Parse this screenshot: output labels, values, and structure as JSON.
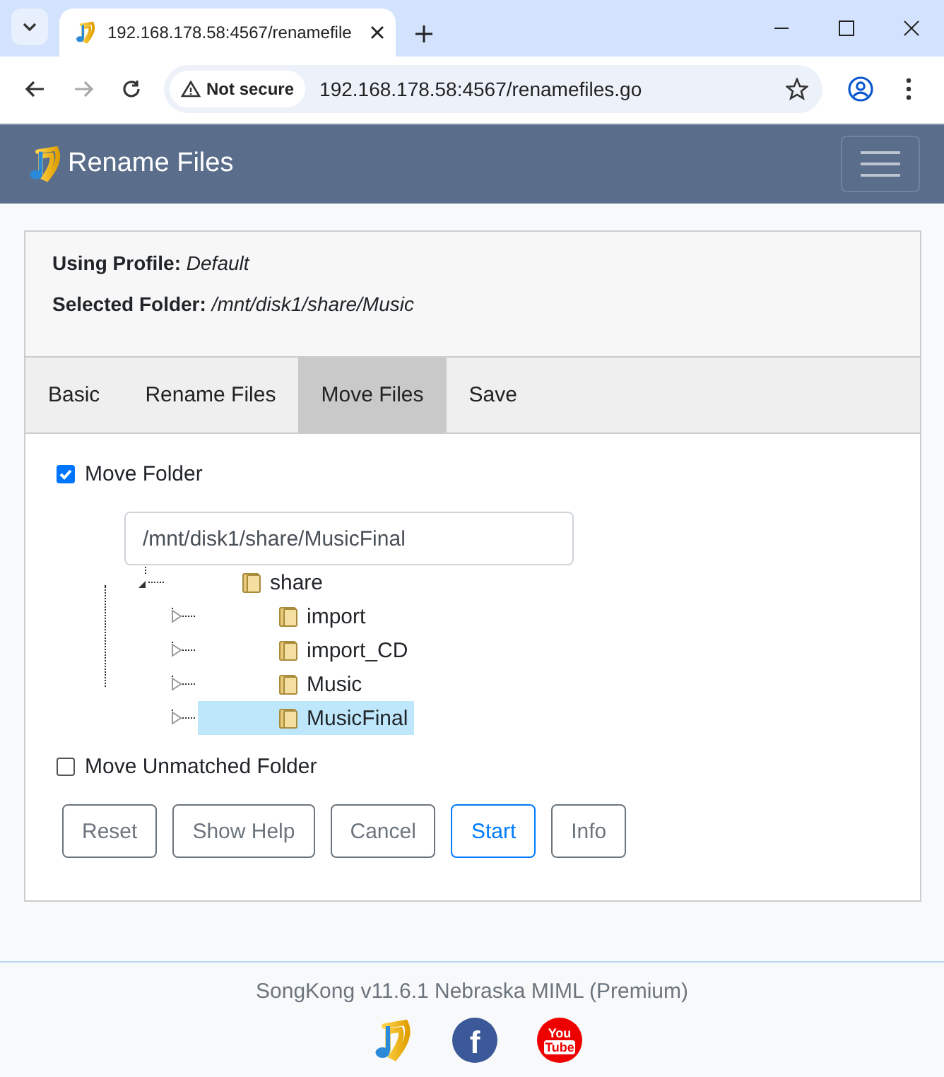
{
  "browser": {
    "tab_title": "192.168.178.58:4567/renamefile",
    "security": "Not secure",
    "url": "192.168.178.58:4567/renamefiles.go"
  },
  "navbar": {
    "title": "Rename Files"
  },
  "profile": [
    {
      "label": "Using Profile:",
      "value": "Default"
    },
    {
      "label": "Selected Folder:",
      "value": "/mnt/disk1/share/Music"
    }
  ],
  "tabs": [
    {
      "label": "Basic",
      "selected": false
    },
    {
      "label": "Rename Files",
      "selected": false
    },
    {
      "label": "Move Files",
      "selected": true
    },
    {
      "label": "Save",
      "selected": false
    }
  ],
  "move_folder": {
    "label": "Move Folder",
    "checked": true,
    "path": "/mnt/disk1/share/MusicFinal"
  },
  "tree": [
    {
      "name": "share",
      "expanded": true,
      "selected": false,
      "children": [
        {
          "name": "import",
          "expanded": false,
          "selected": false
        },
        {
          "name": "import_CD",
          "expanded": false,
          "selected": false
        },
        {
          "name": "Music",
          "expanded": false,
          "selected": false
        },
        {
          "name": "MusicFinal",
          "expanded": false,
          "selected": true
        }
      ]
    }
  ],
  "move_unmatched": {
    "label": "Move Unmatched Folder",
    "checked": false
  },
  "buttons": [
    {
      "label": "Reset",
      "kind": "default"
    },
    {
      "label": "Show Help",
      "kind": "default"
    },
    {
      "label": "Cancel",
      "kind": "default"
    },
    {
      "label": "Start",
      "kind": "primary"
    },
    {
      "label": "Info",
      "kind": "default"
    }
  ],
  "footer": {
    "version": "SongKong v11.6.1 Nebraska MIML (Premium)",
    "facebook_glyph": "f",
    "youtube_top": "You",
    "youtube_bottom": "Tube"
  }
}
